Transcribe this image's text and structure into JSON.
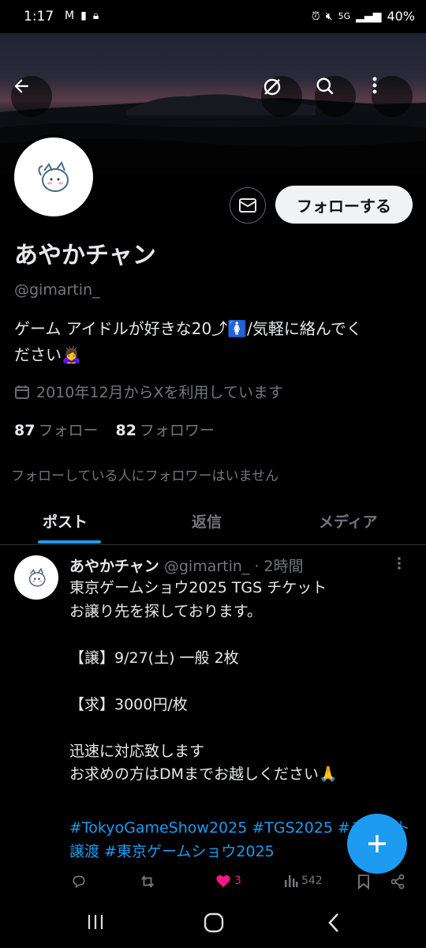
{
  "status_bar": {
    "time": "1:17",
    "left_icons": [
      "gmail-icon",
      "sd-card-icon",
      "lock-icon"
    ],
    "right_icons": [
      "alarm-icon",
      "mute-icon",
      "5g-icon",
      "signal-icon"
    ],
    "network": "5G",
    "battery": "40%"
  },
  "profile": {
    "name": "あやかチャン",
    "handle": "@gimartin_",
    "bio_line1": "ゲーム アイドルが好きな20⤴🚺/気軽に絡んでく",
    "bio_line2": "ださい🙇‍♀️",
    "joined": "2010年12月からXを利用しています",
    "following_count": "87",
    "following_label": "フォロー",
    "followers_count": "82",
    "followers_label": "フォロワー",
    "no_mutual_text": "フォローしている人にフォロワーはいません",
    "follow_button": "フォローする"
  },
  "tabs": [
    {
      "label": "ポスト",
      "active": true
    },
    {
      "label": "返信",
      "active": false
    },
    {
      "label": "メディア",
      "active": false
    }
  ],
  "tweet": {
    "name": "あやかチャン",
    "meta": " @gimartin_ · 2時間",
    "body": "東京ゲームショウ2025 TGS チケット\nお譲り先を探しております。\n\n【譲】9/27(土) 一般 2枚\n\n【求】3000円/枚\n\n迅速に対応致します\nお求めの方はDMまでお越しください🙏",
    "hashtags": "#TokyoGameShow2025 #TGS2025 #チケット譲渡 #東京ゲームショウ2025",
    "likes": "3",
    "views": "542"
  },
  "colors": {
    "accent": "#1d9bf0",
    "like": "#f91880",
    "secondary_text": "#71767b",
    "primary_text": "#e7e9ea",
    "background": "#000000"
  }
}
